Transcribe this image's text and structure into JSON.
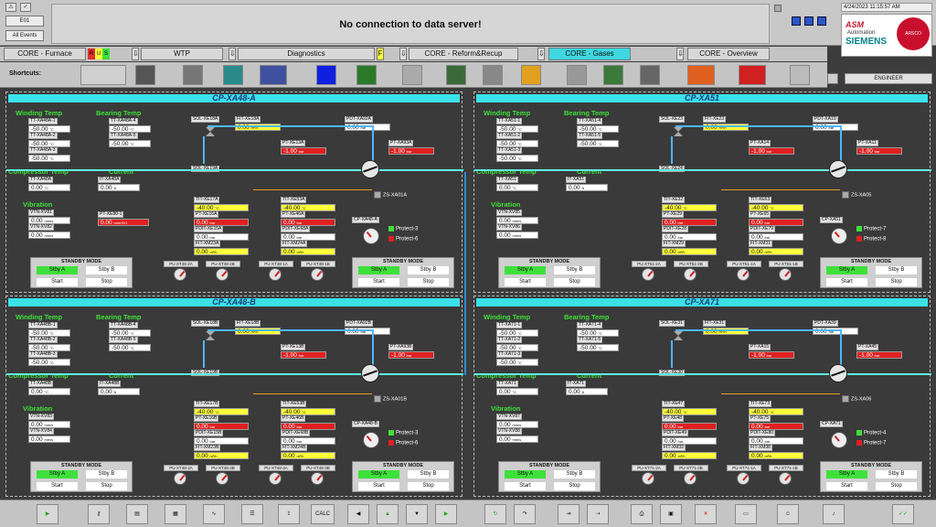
{
  "top": {
    "event_label": "E01",
    "all_events_label": "All Events",
    "message": "No connection to data server!",
    "clock": "4/24/2023 11:15:57 AM",
    "logo_asm": "ASM",
    "logo_automation": "Automation",
    "logo_siemens": "SIEMENS",
    "logo_circle": "ARSCO",
    "user": "ENGINEER"
  },
  "nav": [
    {
      "label": "CORE - Furnace",
      "active": false
    },
    {
      "label": "WTP",
      "active": false
    },
    {
      "label": "Diagnostics",
      "active": false
    },
    {
      "label": "CORE - Reform&Recup",
      "active": false
    },
    {
      "label": "CORE - Gases",
      "active": true
    },
    {
      "label": "CORE - Overview",
      "active": false
    }
  ],
  "rus": [
    "R",
    "U",
    "S"
  ],
  "diag_flag": "F",
  "shortcuts_label": "Shortcuts:",
  "colors": {
    "green": "#3ee03a",
    "cyan": "#3ae0ea",
    "red": "#e02020",
    "yellow": "#ffff38"
  },
  "panels": [
    {
      "title": "CP-XA48-A",
      "winding_label": "Winding Temp",
      "winding": [
        {
          "tag": "TT-XA48A-1",
          "val": "-50.00",
          "unit": "°C"
        },
        {
          "tag": "TT-XA48A-2",
          "val": "-50.00",
          "unit": "°C"
        },
        {
          "tag": "TT-XA48A-3",
          "val": "-50.00",
          "unit": "°C"
        }
      ],
      "bearing_label": "Bearing Temp",
      "bearing": [
        {
          "tag": "TT-XA48A-4",
          "val": "-50.00",
          "unit": "°C"
        },
        {
          "tag": "TT-XA48A-5",
          "val": "-50.00",
          "unit": "°C"
        }
      ],
      "comp_label": "Compressor Temp",
      "comp": {
        "tag": "TT-XA48A",
        "val": "0.00",
        "unit": "°C"
      },
      "current_label": "Current",
      "current": {
        "tag": "IT-XA48A",
        "val": "0.00",
        "unit": "A"
      },
      "vibration_label": "Vibration",
      "vib": [
        {
          "tag": "VTN-XV81",
          "val": "0.00",
          "unit": "mm/s"
        },
        {
          "tag": "VTN-XV82",
          "val": "0.00",
          "unit": "mm/s"
        }
      ],
      "mmh2o": {
        "tag": "PT-XE80-1",
        "val": "0.00",
        "unit": "mmH2O"
      },
      "sol1": "SOL-XE18A",
      "fit1": {
        "tag": "FIT-XE18A",
        "val": "0.00",
        "unit": "m³/h"
      },
      "pdt": {
        "tag": "PDT-XA92A",
        "val": "0.00",
        "unit": "bar"
      },
      "pt_a": {
        "tag": "PT-XE13A",
        "val": "-1.00",
        "unit": "bar"
      },
      "pt_b": {
        "tag": "PT-XA93A",
        "val": "-1.00",
        "unit": "bar"
      },
      "sol2": "SOL-XE19A",
      "zs": "ZS-XA01A",
      "tit1": {
        "tag": "TIT-XE17A",
        "val": "-40.00",
        "unit": "°C"
      },
      "pt1": {
        "tag": "PT-XE16A",
        "val": "0.00",
        "unit": "bar"
      },
      "pdit1": {
        "tag": "PDIT-XE15A",
        "val": "0.00",
        "unit": "bar"
      },
      "fit2": {
        "tag": "FIT-XM23A",
        "val": "0.00",
        "unit": "m³/h"
      },
      "tit2": {
        "tag": "TIT-XE53A",
        "val": "-40.00",
        "unit": "°C"
      },
      "pt2": {
        "tag": "PT-XE46A",
        "val": "0.00",
        "unit": "bar"
      },
      "pdit2": {
        "tag": "PDIT-XE68A",
        "val": "0.00",
        "unit": "bar"
      },
      "fit3": {
        "tag": "FIT-XM24A",
        "val": "0.00",
        "unit": "m³/h"
      },
      "cp": "CP-XA48-A",
      "protect": [
        "Protect-3",
        "Protect-6"
      ],
      "standby": {
        "header": "STANDBY MODE",
        "a": "Stby A",
        "b": "Stby B",
        "start": "Start",
        "stop": "Stop"
      },
      "pumps": [
        "PU-XT48-2A",
        "PU-XT48-2B",
        "PU-XT48-1A",
        "PU-XT48-1B"
      ]
    },
    {
      "title": "CP-XA51",
      "winding_label": "Winding Temp",
      "winding": [
        {
          "tag": "TT-XA51-1",
          "val": "-50.00",
          "unit": "°C"
        },
        {
          "tag": "TT-XA51-2",
          "val": "-50.00",
          "unit": "°C"
        },
        {
          "tag": "TT-XA51-3",
          "val": "-50.00",
          "unit": "°C"
        }
      ],
      "bearing_label": "Bearing Temp",
      "bearing": [
        {
          "tag": "TT-XA51-4",
          "val": "-50.00",
          "unit": "°C"
        },
        {
          "tag": "TT-XA51-5",
          "val": "-50.00",
          "unit": "°C"
        }
      ],
      "comp_label": "Compressor Temp",
      "comp": {
        "tag": "TT-XA51",
        "val": "0.00",
        "unit": "°C"
      },
      "current_label": "Current",
      "current": {
        "tag": "IT-XA51",
        "val": "0.00",
        "unit": "A"
      },
      "vibration_label": "Vibration",
      "vib": [
        {
          "tag": "VTN-XV85",
          "val": "0.00",
          "unit": "mm/s"
        },
        {
          "tag": "VTN-XV86",
          "val": "0.00",
          "unit": "mm/s"
        }
      ],
      "sol1": "SOL-XE23",
      "fit1": {
        "tag": "FIT-XE23",
        "val": "0.00",
        "unit": "m³/h"
      },
      "pdt": {
        "tag": "PDT-XA10",
        "val": "0.00",
        "unit": "bar"
      },
      "pt_a": {
        "tag": "PT-XA14",
        "val": "-1.00",
        "unit": "bar"
      },
      "pt_b": {
        "tag": "PT-XA11",
        "val": "-1.00",
        "unit": "bar"
      },
      "sol2": "SOL-XE24",
      "zs": "ZS-XA05",
      "tit1": {
        "tag": "TIT-XE32",
        "val": "-40.00",
        "unit": "°C"
      },
      "pt1": {
        "tag": "PT-XE29",
        "val": "0.00",
        "unit": "bar"
      },
      "pdit1": {
        "tag": "PDIT-XE28",
        "val": "0.00",
        "unit": "bar"
      },
      "fit2": {
        "tag": "FIT-XM29",
        "val": "0.00",
        "unit": "m³/h"
      },
      "tit2": {
        "tag": "TIT-XE63",
        "val": "-40.00",
        "unit": "°C"
      },
      "pt2": {
        "tag": "PT-XE65",
        "val": "0.00",
        "unit": "bar"
      },
      "pdit2": {
        "tag": "PDIT-XE79",
        "val": "0.00",
        "unit": "bar"
      },
      "fit3": {
        "tag": "FIT-XM31",
        "val": "0.00",
        "unit": "m³/h"
      },
      "cp": "CP-XA51",
      "protect": [
        "Protect-7",
        "Protect-8"
      ],
      "standby": {
        "header": "STANDBY MODE",
        "a": "Stby A",
        "b": "Stby B",
        "start": "Start",
        "stop": "Stop"
      },
      "pumps": [
        "PU-XT51-2A",
        "PU-XT51-2B",
        "PU-XT51-1A",
        "PU-XT51-1B"
      ]
    },
    {
      "title": "CP-XA48-B",
      "winding_label": "Winding Temp",
      "winding": [
        {
          "tag": "TT-XA48B-1",
          "val": "-50.00",
          "unit": "°C"
        },
        {
          "tag": "TT-XA48B-2",
          "val": "-50.00",
          "unit": "°C"
        },
        {
          "tag": "TT-XA48B-3",
          "val": "-50.00",
          "unit": "°C"
        }
      ],
      "bearing_label": "Bearing Temp",
      "bearing": [
        {
          "tag": "TT-XA48B-4",
          "val": "-50.00",
          "unit": "°C"
        },
        {
          "tag": "TT-XA48B-5",
          "val": "-50.00",
          "unit": "°C"
        }
      ],
      "comp_label": "Compressor Temp",
      "comp": {
        "tag": "TT-XA48B",
        "val": "0.00",
        "unit": "°C"
      },
      "current_label": "Current",
      "current": {
        "tag": "IT-XA48B",
        "val": "0.00",
        "unit": "A"
      },
      "vibration_label": "Vibration",
      "vib": [
        {
          "tag": "VTN-XV83",
          "val": "0.00",
          "unit": "mm/s"
        },
        {
          "tag": "VTN-XV84",
          "val": "0.00",
          "unit": "mm/s"
        }
      ],
      "sol1": "SOL-XE18B",
      "fit1": {
        "tag": "FIT-XE18B",
        "val": "0.00",
        "unit": "m³/h"
      },
      "pdt": {
        "tag": "PDT-XA92B",
        "val": "0.00",
        "unit": "bar"
      },
      "pt_a": {
        "tag": "PT-XE13B",
        "val": "-1.00",
        "unit": "bar"
      },
      "pt_b": {
        "tag": "PT-XA93B",
        "val": "-1.00",
        "unit": "bar"
      },
      "sol2": "SOL-XE19B",
      "zs": "ZS-XA01B",
      "tit1": {
        "tag": "TIT-XE17B",
        "val": "-40.00",
        "unit": "°C"
      },
      "pt1": {
        "tag": "PT-XE16B",
        "val": "0.00",
        "unit": "bar"
      },
      "pdit1": {
        "tag": "PDIT-XE15B",
        "val": "0.00",
        "unit": "bar"
      },
      "fit2": {
        "tag": "FIT-XM23B",
        "val": "0.00",
        "unit": "m³/h"
      },
      "tit2": {
        "tag": "TIT-XE53B",
        "val": "-40.00",
        "unit": "°C"
      },
      "pt2": {
        "tag": "PT-XE46B",
        "val": "0.00",
        "unit": "bar"
      },
      "pdit2": {
        "tag": "PDIT-XE68B",
        "val": "0.00",
        "unit": "bar"
      },
      "fit3": {
        "tag": "FIT-XM24B",
        "val": "0.00",
        "unit": "m³/h"
      },
      "cp": "CP-XA48-B",
      "protect": [
        "Protect-3",
        "Protect-6"
      ],
      "standby": {
        "header": "STANDBY MODE",
        "a": "Stby A",
        "b": "Stby B",
        "start": "Start",
        "stop": "Stop"
      },
      "pumps": [
        "PU-XT48-4A",
        "PU-XT48-4B",
        "PU-XT48-3A",
        "PU-XT48-3B"
      ]
    },
    {
      "title": "CP-XA71",
      "winding_label": "Winding Temp",
      "winding": [
        {
          "tag": "TT-XA71-1",
          "val": "-50.00",
          "unit": "°C"
        },
        {
          "tag": "TT-XA71-2",
          "val": "-50.00",
          "unit": "°C"
        },
        {
          "tag": "TT-XA71-3",
          "val": "-50.00",
          "unit": "°C"
        }
      ],
      "bearing_label": "Bearing Temp",
      "bearing": [
        {
          "tag": "TT-XA71-4",
          "val": "-50.00",
          "unit": "°C"
        },
        {
          "tag": "TT-XA71-5",
          "val": "-50.00",
          "unit": "°C"
        }
      ],
      "comp_label": "Compressor Temp",
      "comp": {
        "tag": "TT-XA71",
        "val": "0.00",
        "unit": "°C"
      },
      "current_label": "Current",
      "current": {
        "tag": "IT-XA71",
        "val": "0.00",
        "unit": "A"
      },
      "vibration_label": "Vibration",
      "vib": [
        {
          "tag": "VTN-XV87",
          "val": "0.00",
          "unit": "mm/s"
        },
        {
          "tag": "VTN-XV88",
          "val": "0.00",
          "unit": "mm/s"
        }
      ],
      "sol1": "SOL-XE31",
      "fit1": {
        "tag": "FIT-XE31",
        "val": "0.00",
        "unit": "m³/h"
      },
      "pdt": {
        "tag": "PDT-XA39",
        "val": "0.00",
        "unit": "bar"
      },
      "pt_a": {
        "tag": "PT-XA15",
        "val": "-1.00",
        "unit": "bar"
      },
      "pt_b": {
        "tag": "PT-XA45",
        "val": "-1.00",
        "unit": "bar"
      },
      "sol2": "SOL-XE30",
      "zs": "ZS-XA06",
      "tit1": {
        "tag": "TIT-XE47",
        "val": "-40.00",
        "unit": "°C"
      },
      "pt1": {
        "tag": "PT-XE48",
        "val": "0.00",
        "unit": "bar"
      },
      "pdit1": {
        "tag": "PDIT-XE49",
        "val": "0.00",
        "unit": "bar"
      },
      "fit2": {
        "tag": "FIT-XM33",
        "val": "0.00",
        "unit": "m³/h"
      },
      "tit2": {
        "tag": "TIT-XE73",
        "val": "-40.00",
        "unit": "°C"
      },
      "pt2": {
        "tag": "PT-XE75",
        "val": "0.00",
        "unit": "bar"
      },
      "pdit2": {
        "tag": "PDIT-XE80",
        "val": "0.00",
        "unit": "bar"
      },
      "fit3": {
        "tag": "FIT-XM38",
        "val": "0.00",
        "unit": "m³/h"
      },
      "cp": "CP-XA71",
      "protect": [
        "Protect-4",
        "Protect-7"
      ],
      "standby": {
        "header": "STANDBY MODE",
        "a": "Stby A",
        "b": "Stby B",
        "start": "Start",
        "stop": "Stop"
      },
      "pumps": [
        "PU-XT71-2A",
        "PU-XT71-2B",
        "PU-XT71-1A",
        "PU-XT71-1B"
      ]
    }
  ],
  "toolbar": {
    "calc_label": "CALC"
  }
}
